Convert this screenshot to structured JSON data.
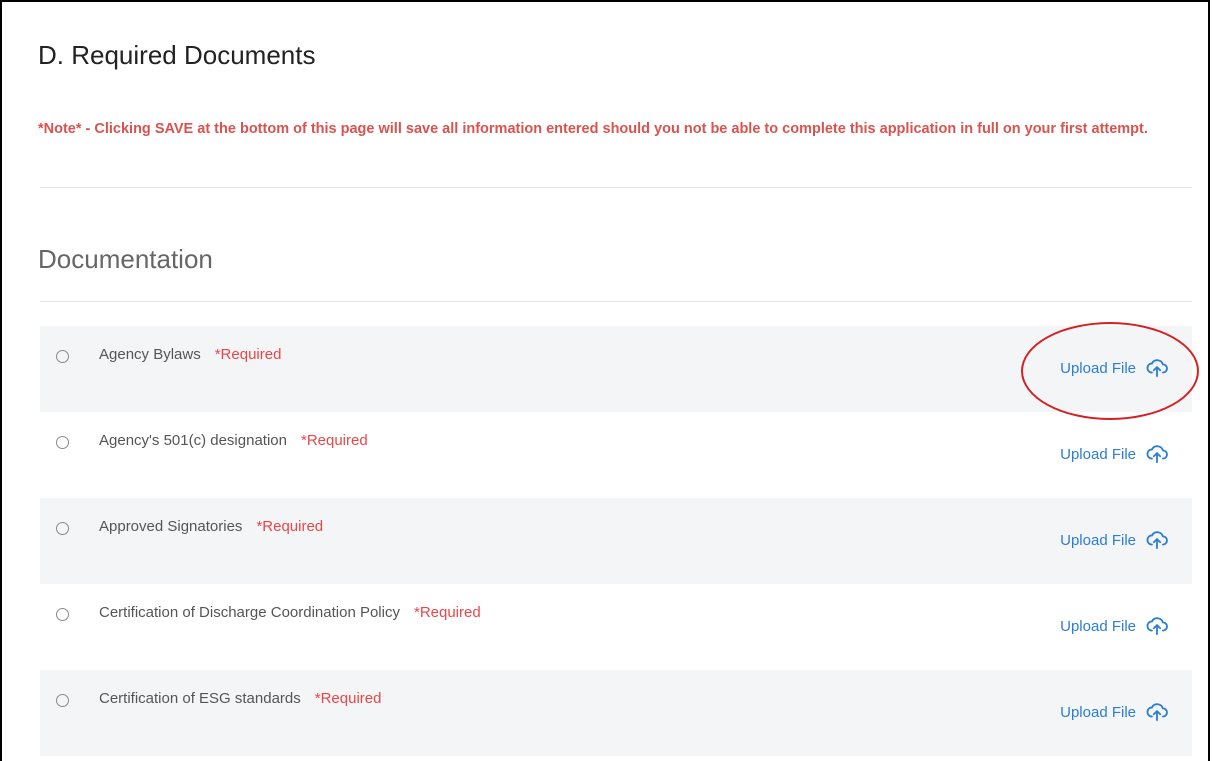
{
  "page": {
    "title": "D. Required Documents",
    "note": "*Note* - Clicking SAVE at the bottom of this page will save all information entered should you not be able to complete this application in full on your first attempt."
  },
  "documentation": {
    "section_title": "Documentation",
    "upload_label": "Upload File",
    "required_label": "*Required",
    "items": [
      {
        "label": "Agency Bylaws"
      },
      {
        "label": "Agency's 501(c) designation"
      },
      {
        "label": "Approved Signatories"
      },
      {
        "label": "Certification of Discharge Coordination Policy"
      },
      {
        "label": "Certification of ESG standards"
      }
    ]
  },
  "colors": {
    "note_red": "#d9534f",
    "required_red": "#e8474a",
    "link_blue": "#2b7ed1",
    "row_shade": "#f4f5f7",
    "annotation_red": "#d42020"
  },
  "icons": {
    "upload": "cloud-upload-icon",
    "radio": "radio-circle-icon"
  }
}
